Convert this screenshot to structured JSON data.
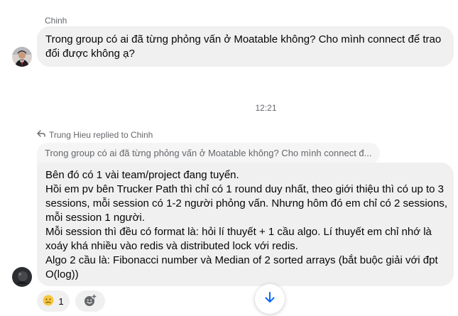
{
  "messages": [
    {
      "sender": "Chinh",
      "lines": [
        "Trong group có ai đã từng phỏng vấn ở Moatable không? Cho mình connect để trao",
        "đổi được không ạ?"
      ]
    }
  ],
  "timestamp": "12:21",
  "reply": {
    "note": "Trung Hieu replied to Chinh",
    "quoted": "Trong group có ai đã từng phỏng vấn ở Moatable không? Cho mình connect đ...",
    "lines": [
      "Bên đó có 1 vài team/project đang tuyển.",
      "Hồi em pv bên Trucker Path thì chỉ có 1 round duy nhất, theo giới thiệu thì có up to 3",
      "sessions, mỗi session có 1-2 người phỏng vấn. Nhưng hôm đó em chỉ có 2 sessions,",
      "mỗi session 1 người.",
      "Mỗi session thì đều có format là: hỏi lí thuyết + 1 cầu algo.  Lí thuyết em chỉ nhớ là",
      "xoáy khá nhiều vào redis và distributed lock với redis.",
      "Algo 2 cầu là: Fibonacci number và Median of 2 sorted arrays (bắt buộc giải với đpt",
      "O(log))"
    ]
  },
  "reactions": {
    "emoji": "sad-face",
    "count": "1"
  },
  "icons": [
    "reply-arrow-icon",
    "add-reaction-icon",
    "scroll-down-icon"
  ],
  "colors": {
    "bubble": "#f0f0f0",
    "muted_text": "#65676b",
    "accent": "#0866ff"
  }
}
